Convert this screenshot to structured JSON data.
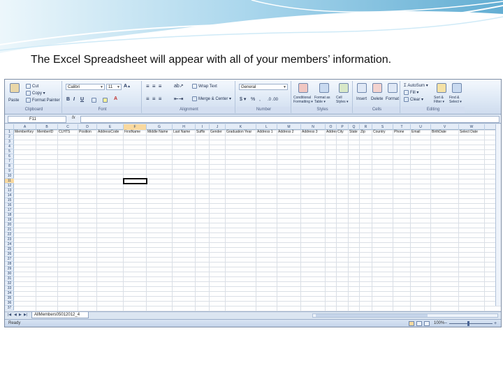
{
  "caption": "The Excel Spreadsheet will appear with all of your members’ information.",
  "ribbon": {
    "clipboard": {
      "title": "Clipboard",
      "paste": "Paste",
      "cut": "Cut",
      "copy": "Copy ▾",
      "format_painter": "Format Painter"
    },
    "font": {
      "title": "Font",
      "name": "Calibri",
      "size": "11",
      "bold": "B",
      "italic": "I",
      "underline": "U"
    },
    "alignment": {
      "title": "Alignment",
      "wrap_text": "Wrap Text",
      "merge_center": "Merge & Center ▾"
    },
    "number": {
      "title": "Number",
      "format": "General",
      "currency": "$ ▾",
      "percent": "%",
      "comma": ","
    },
    "styles": {
      "title": "Styles",
      "conditional": "Conditional Formatting ▾",
      "format_table": "Format as Table ▾",
      "cell_styles": "Cell Styles ▾"
    },
    "cells": {
      "title": "Cells",
      "insert": "Insert",
      "delete": "Delete",
      "format": "Format"
    },
    "editing": {
      "title": "Editing",
      "autosum": "Σ AutoSum ▾",
      "fill": "Fill ▾",
      "clear": "Clear ▾",
      "sort_filter": "Sort & Filter ▾",
      "find_select": "Find & Select ▾"
    }
  },
  "formula_bar": {
    "name_box": "F11",
    "fx": "fx",
    "formula": ""
  },
  "columns": [
    "A",
    "B",
    "C",
    "D",
    "E",
    "F",
    "G",
    "H",
    "I",
    "J",
    "K",
    "L",
    "M",
    "N",
    "O",
    "P",
    "Q",
    "R",
    "S",
    "T",
    "U",
    "V",
    "W"
  ],
  "selected_column": "F",
  "headers": [
    "MemberKey",
    "MemberID",
    "CLHTS",
    "Position",
    "AddressCode",
    "FirstName",
    "Middle Name",
    "Last Name",
    "Suffix",
    "Gender",
    "Graduation Year",
    "Address 1",
    "Address 2",
    "Address 3",
    "Address 4",
    "City",
    "State",
    "Zip",
    "Country",
    "Phone",
    "Email",
    "BirthDate",
    "Select Date"
  ],
  "row_count": 37,
  "selected_row": 11,
  "sheet_tab": "AllMembers05012012_4",
  "status": {
    "ready": "Ready",
    "zoom": "100%",
    "minus": "−",
    "plus": "+"
  }
}
